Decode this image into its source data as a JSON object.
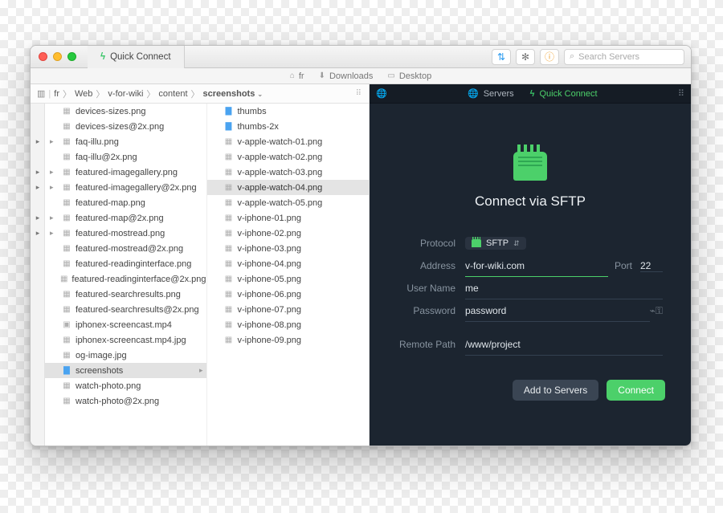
{
  "titlebar": {
    "tab_label": "Quick Connect",
    "search_placeholder": "Search Servers"
  },
  "favorites": [
    {
      "icon": "home",
      "label": "fr"
    },
    {
      "icon": "download",
      "label": "Downloads"
    },
    {
      "icon": "desktop",
      "label": "Desktop"
    }
  ],
  "breadcrumb": [
    "fr",
    "Web",
    "v-for-wiki",
    "content",
    "screenshots"
  ],
  "columns": {
    "col1": [
      {
        "name": "devices-sizes.png",
        "type": "img",
        "expandable": false
      },
      {
        "name": "devices-sizes@2x.png",
        "type": "img",
        "expandable": false
      },
      {
        "name": "faq-illu.png",
        "type": "img",
        "expandable": true
      },
      {
        "name": "faq-illu@2x.png",
        "type": "img",
        "expandable": false
      },
      {
        "name": "featured-imagegallery.png",
        "type": "img",
        "expandable": true
      },
      {
        "name": "featured-imagegallery@2x.png",
        "type": "img",
        "expandable": true
      },
      {
        "name": "featured-map.png",
        "type": "img",
        "expandable": false
      },
      {
        "name": "featured-map@2x.png",
        "type": "img",
        "expandable": true
      },
      {
        "name": "featured-mostread.png",
        "type": "img",
        "expandable": true
      },
      {
        "name": "featured-mostread@2x.png",
        "type": "img",
        "expandable": false
      },
      {
        "name": "featured-readinginterface.png",
        "type": "img",
        "expandable": false
      },
      {
        "name": "featured-readinginterface@2x.png",
        "type": "img",
        "expandable": false
      },
      {
        "name": "featured-searchresults.png",
        "type": "img",
        "expandable": false
      },
      {
        "name": "featured-searchresults@2x.png",
        "type": "img",
        "expandable": false
      },
      {
        "name": "iphonex-screencast.mp4",
        "type": "vid",
        "expandable": false
      },
      {
        "name": "iphonex-screencast.mp4.jpg",
        "type": "img",
        "expandable": false
      },
      {
        "name": "og-image.jpg",
        "type": "img",
        "expandable": false
      },
      {
        "name": "screenshots",
        "type": "folder",
        "expandable": false,
        "selected": true
      },
      {
        "name": "watch-photo.png",
        "type": "img",
        "expandable": false
      },
      {
        "name": "watch-photo@2x.png",
        "type": "img",
        "expandable": false
      }
    ],
    "col2": [
      {
        "name": "thumbs",
        "type": "folder"
      },
      {
        "name": "thumbs-2x",
        "type": "folder"
      },
      {
        "name": "v-apple-watch-01.png",
        "type": "img"
      },
      {
        "name": "v-apple-watch-02.png",
        "type": "img"
      },
      {
        "name": "v-apple-watch-03.png",
        "type": "img"
      },
      {
        "name": "v-apple-watch-04.png",
        "type": "img",
        "selected": true
      },
      {
        "name": "v-apple-watch-05.png",
        "type": "img"
      },
      {
        "name": "v-iphone-01.png",
        "type": "img"
      },
      {
        "name": "v-iphone-02.png",
        "type": "img"
      },
      {
        "name": "v-iphone-03.png",
        "type": "img"
      },
      {
        "name": "v-iphone-04.png",
        "type": "img"
      },
      {
        "name": "v-iphone-05.png",
        "type": "img"
      },
      {
        "name": "v-iphone-06.png",
        "type": "img"
      },
      {
        "name": "v-iphone-07.png",
        "type": "img"
      },
      {
        "name": "v-iphone-08.png",
        "type": "img"
      },
      {
        "name": "v-iphone-09.png",
        "type": "img"
      }
    ]
  },
  "rightpane": {
    "tab_servers": "Servers",
    "tab_quick": "Quick Connect",
    "title": "Connect via SFTP",
    "labels": {
      "protocol": "Protocol",
      "address": "Address",
      "port": "Port",
      "username": "User Name",
      "password": "Password",
      "remote_path": "Remote Path"
    },
    "values": {
      "protocol": "SFTP",
      "address": "v-for-wiki.com",
      "port": "22",
      "username": "me",
      "password": "password",
      "remote_path": "/www/project"
    },
    "buttons": {
      "add": "Add to Servers",
      "connect": "Connect"
    }
  }
}
